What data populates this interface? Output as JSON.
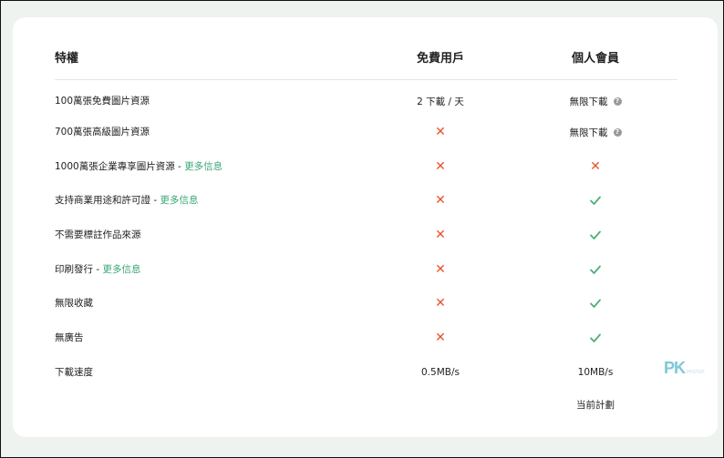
{
  "header": {
    "feature": "特權",
    "free": "免費用戶",
    "member": "個人會員"
  },
  "rows": [
    {
      "feature": "100萬張免費圖片資源",
      "more": "",
      "free": "2 下載 / 天",
      "member": "無限下載",
      "member_info": true
    },
    {
      "feature": "700萬張高級圖片資源",
      "more": "",
      "free": "cross",
      "member": "無限下載",
      "member_info": true
    },
    {
      "feature": "1000萬張企業專享圖片資源 - ",
      "more": "更多信息",
      "free": "cross",
      "member": "cross"
    },
    {
      "feature": "支持商業用途和許可證 - ",
      "more": "更多信息",
      "free": "cross",
      "member": "check"
    },
    {
      "feature": "不需要標註作品來源",
      "more": "",
      "free": "cross",
      "member": "check"
    },
    {
      "feature": "印刷發行 - ",
      "more": "更多信息",
      "free": "cross",
      "member": "check"
    },
    {
      "feature": "無限收藏",
      "more": "",
      "free": "cross",
      "member": "check"
    },
    {
      "feature": "無廣告",
      "more": "",
      "free": "cross",
      "member": "check"
    },
    {
      "feature": "下載速度",
      "more": "",
      "free": "0.5MB/s",
      "member": "10MB/s"
    }
  ],
  "current_plan": "当前計劃",
  "info_glyph": "?",
  "cross_glyph": "✕",
  "watermark": {
    "logo": "PK",
    "sub": "PKSTEP"
  },
  "colors": {
    "cross": "#e8522e",
    "check": "#4caf7a",
    "link": "#3aa676",
    "background": "#eef3f0"
  }
}
